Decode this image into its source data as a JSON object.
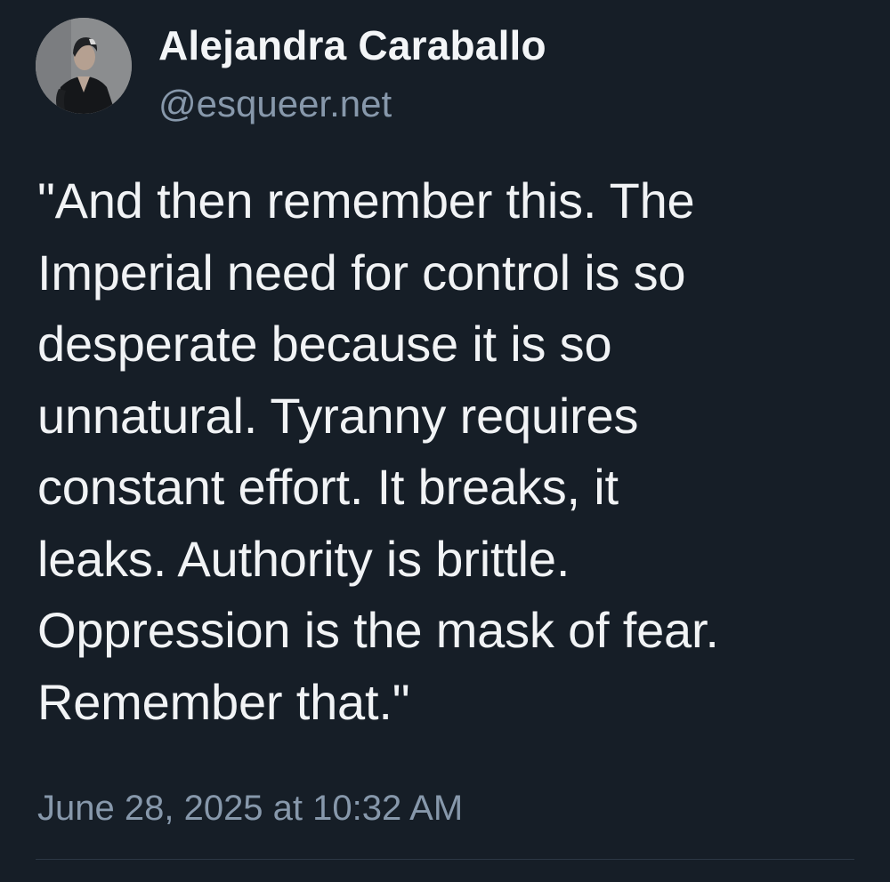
{
  "author": {
    "display_name": "Alejandra Caraballo",
    "handle": "@esqueer.net",
    "avatar_icon": "avatar-photo"
  },
  "post": {
    "text": "\"And then remember this. The\nImperial need for control is so\ndesperate because it is so\nunnatural. Tyranny requires\nconstant effort. It breaks, it\nleaks. Authority is brittle.\nOppression is the mask of fear.\nRemember that.\"",
    "timestamp": "June 28, 2025 at 10:32 AM"
  },
  "colors": {
    "background": "#161e27",
    "primary_text": "#f1f3f5",
    "secondary_text": "#8798ab",
    "divider": "#2c3744"
  }
}
